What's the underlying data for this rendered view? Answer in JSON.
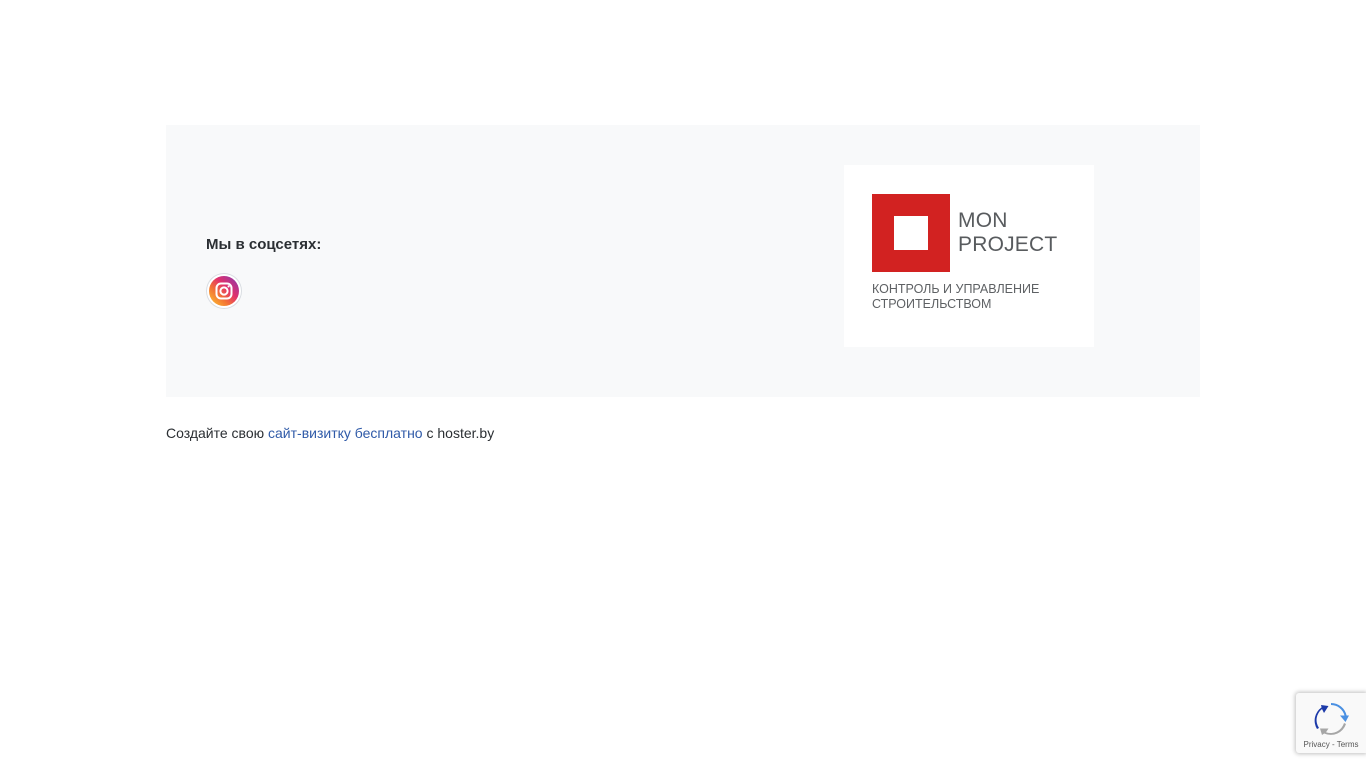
{
  "social": {
    "title": "Мы в соцсетях:",
    "icons": [
      {
        "icon": "instagram-icon"
      }
    ]
  },
  "logo": {
    "name_line1": "MON",
    "name_line2": "PROJECT",
    "tagline_line1": "КОНТРОЛЬ И УПРАВЛЕНИЕ",
    "tagline_line2": "СТРОИТЕЛЬСТВОМ",
    "brand_color": "#d22221"
  },
  "credit": {
    "prefix": "Создайте свою",
    "link_text": "сайт-визитку бесплатно",
    "suffix": "с hoster.by",
    "link_color": "#2f5aa8"
  },
  "recaptcha": {
    "privacy": "Privacy",
    "separator": "-",
    "terms": "Terms",
    "icon": "recaptcha-icon"
  }
}
